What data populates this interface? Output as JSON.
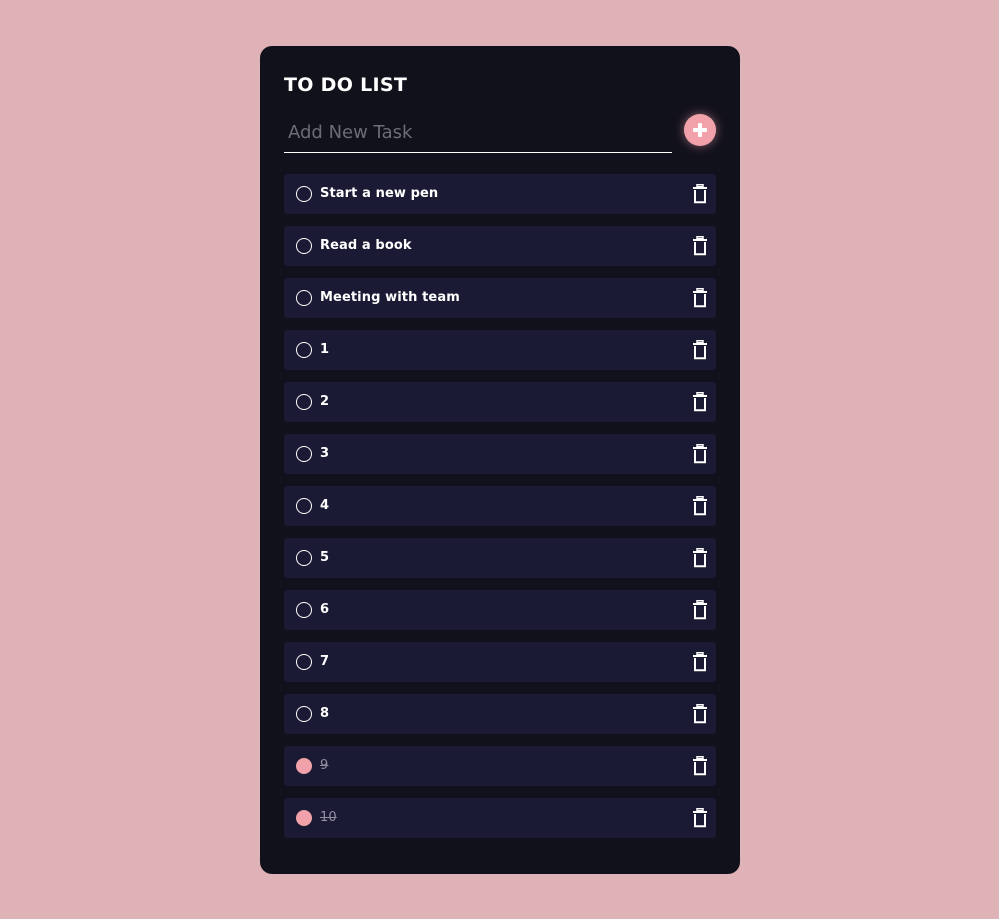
{
  "app": {
    "title": "TO DO LIST"
  },
  "new_task": {
    "placeholder": "Add New Task",
    "value": "",
    "add_icon": "plus-icon"
  },
  "tasks": [
    {
      "text": "Start a new pen",
      "done": false
    },
    {
      "text": "Read a book",
      "done": false
    },
    {
      "text": "Meeting with team",
      "done": false
    },
    {
      "text": "1",
      "done": false
    },
    {
      "text": "2",
      "done": false
    },
    {
      "text": "3",
      "done": false
    },
    {
      "text": "4",
      "done": false
    },
    {
      "text": "5",
      "done": false
    },
    {
      "text": "6",
      "done": false
    },
    {
      "text": "7",
      "done": false
    },
    {
      "text": "8",
      "done": false
    },
    {
      "text": "9",
      "done": true
    },
    {
      "text": "10",
      "done": true
    }
  ],
  "icons": {
    "checkbox": "circle-checkbox-icon",
    "delete": "trash-icon"
  },
  "colors": {
    "background": "#dfb2b7",
    "card": "#11111c",
    "task_row": "#1b1a34",
    "accent": "#f0a1a9",
    "text": "#ffffff"
  }
}
